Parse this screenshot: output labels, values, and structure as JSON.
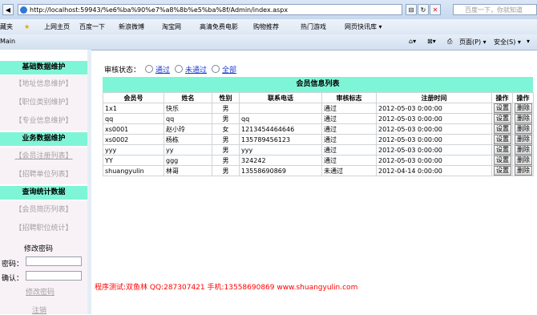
{
  "browser": {
    "url": "http://localhost:59943/%e6%ba%90%e7%a8%8b%e5%ba%8f/Admin/index.aspx",
    "search_placeholder": "百度一下，你就知道",
    "favorites": [
      {
        "label": "藏夹"
      },
      {
        "label": "上网主页"
      },
      {
        "label": "百度一下"
      },
      {
        "label": "新浪微博"
      },
      {
        "label": "淘宝网"
      },
      {
        "label": "高清免费电影"
      },
      {
        "label": "购物推荐"
      },
      {
        "label": "热门游戏"
      },
      {
        "label": "网页快讯库 ▾"
      }
    ],
    "tab_title": "Main",
    "toolbar": {
      "page": "页面(P) ▾",
      "safety": "安全(S) ▾",
      "tools": "▾"
    }
  },
  "sidebar": {
    "sections": [
      {
        "title": "基础数据维护",
        "items": [
          "【地址信息维护】",
          "【职位类别维护】",
          "【专业信息维护】"
        ]
      },
      {
        "title": "业务数据维护",
        "items": [
          "【会员注册列表】",
          "【招聘单位列表】"
        ]
      },
      {
        "title": "查询统计数据",
        "items": [
          "【会员简历列表】",
          "【招聘职位统计】"
        ]
      }
    ],
    "password": {
      "title": "修改密码",
      "new_label": "密码：",
      "confirm_label": "确认：",
      "submit": "修改密码",
      "logout": "注销"
    }
  },
  "filter": {
    "label": "审核状态：",
    "options": [
      "通过",
      "未通过",
      "全部"
    ]
  },
  "table": {
    "title": "会员信息列表",
    "columns": [
      "会员号",
      "姓名",
      "性别",
      "联系电话",
      "审核标志",
      "注册时间",
      "操作",
      "操作"
    ],
    "rows": [
      [
        "1x1",
        "快乐",
        "男",
        "",
        "通过",
        "2012-05-03 0:00:00"
      ],
      [
        "qq",
        "qq",
        "男",
        "qq",
        "通过",
        "2012-05-03 0:00:00"
      ],
      [
        "xs0001",
        "赵小玲",
        "女",
        "1213454464646",
        "通过",
        "2012-05-03 0:00:00"
      ],
      [
        "xs0002",
        "杨栋",
        "男",
        "135789456123",
        "通过",
        "2012-05-03 0:00:00"
      ],
      [
        "yyy",
        "yy",
        "男",
        "yyy",
        "通过",
        "2012-05-03 0:00:00"
      ],
      [
        "YY",
        "ggg",
        "男",
        "324242",
        "通过",
        "2012-05-03 0:00:00"
      ],
      [
        "shuangyulin",
        "林哥",
        "男",
        "13558690869",
        "未通过",
        "2012-04-14 0:00:00"
      ]
    ],
    "action_set": "设置",
    "action_delete": "删除"
  },
  "footer": "程序测试:双鱼林 QQ:287307421 手机:13558690869 www.shuangyulin.com",
  "colors": {
    "header_bg": "#7ff5d7",
    "footer_text": "#ff0000",
    "link": "#1a3bd6"
  }
}
